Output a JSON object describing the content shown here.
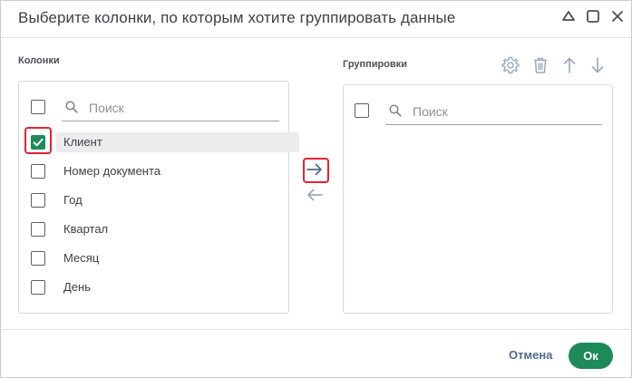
{
  "dialog": {
    "title": "Выберите колонки, по которым хотите группировать данные",
    "window_buttons": [
      {
        "icon": "collapse-icon"
      },
      {
        "icon": "maximize-icon"
      },
      {
        "icon": "close-icon"
      }
    ]
  },
  "columns_panel": {
    "label": "Колонки",
    "search_placeholder": "Поиск",
    "items": [
      {
        "label": "Клиент",
        "checked": true,
        "selected": true
      },
      {
        "label": "Номер документа",
        "checked": false
      },
      {
        "label": "Год",
        "checked": false
      },
      {
        "label": "Квартал",
        "checked": false
      },
      {
        "label": "Месяц",
        "checked": false
      },
      {
        "label": "День",
        "checked": false
      }
    ]
  },
  "groupings_panel": {
    "label": "Группировки",
    "search_placeholder": "Поиск",
    "toolbar": [
      "gear-icon",
      "trash-icon",
      "arrow-up-icon",
      "arrow-down-icon"
    ],
    "items": []
  },
  "transfer": {
    "add_icon": "arrow-right-icon",
    "remove_icon": "arrow-left-icon"
  },
  "footer": {
    "cancel_label": "Отмена",
    "ok_label": "Ок"
  },
  "colors": {
    "accent": "#1e8a5a",
    "highlight": "#e02434",
    "cancel_text": "#4f6a8c"
  }
}
